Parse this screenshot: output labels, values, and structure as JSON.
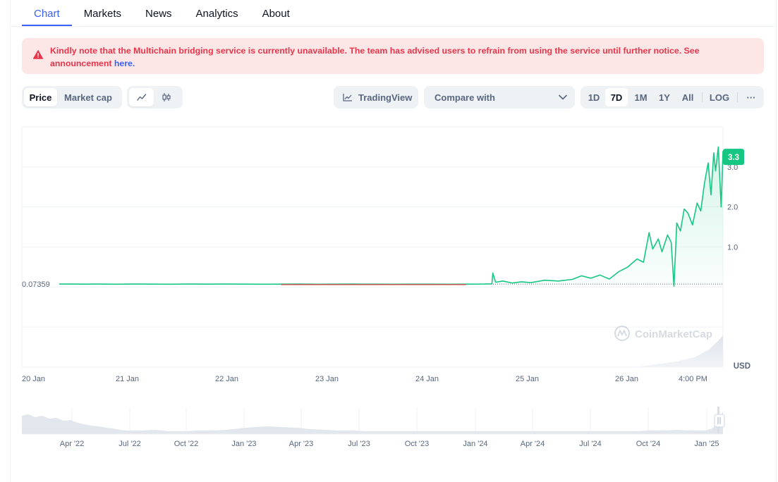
{
  "tabs": [
    "Chart",
    "Markets",
    "News",
    "Analytics",
    "About"
  ],
  "alert": {
    "text": "Kindly note that the Multichain bridging service is currently unavailable. The team has advised users to refrain from using the service until further notice. See announcement",
    "link": "here."
  },
  "toolbar": {
    "price_label": "Price",
    "marketcap_label": "Market cap",
    "tradingview_label": "TradingView",
    "compare_label": "Compare with",
    "ranges": [
      "1D",
      "7D",
      "1M",
      "1Y",
      "All"
    ],
    "active_range": "7D",
    "log_label": "LOG",
    "more_label": "···"
  },
  "chart_data": {
    "type": "line",
    "x_labels": [
      "20 Jan",
      "21 Jan",
      "22 Jan",
      "23 Jan",
      "24 Jan",
      "25 Jan",
      "26 Jan",
      "4:00 PM"
    ],
    "y_ticks": [
      "1.0",
      "2.0",
      "3.0"
    ],
    "current_price": "3.3",
    "reference_price": "0.07359",
    "currency": "USD",
    "watermark": "CoinMarketCap",
    "ylim": [
      -2,
      4
    ],
    "reference_value": 0.07359,
    "series": [
      {
        "points": [
          [
            0,
            0.074
          ],
          [
            0.1,
            0.075
          ],
          [
            0.25,
            0.072
          ],
          [
            0.4,
            0.074
          ],
          [
            0.6,
            0.071
          ],
          [
            0.8,
            0.075
          ],
          [
            1.0,
            0.073
          ],
          [
            1.2,
            0.071
          ],
          [
            1.4,
            0.074
          ],
          [
            1.6,
            0.072
          ],
          [
            1.8,
            0.075
          ],
          [
            2.0,
            0.072
          ],
          [
            2.2,
            0.071
          ],
          [
            2.4,
            0.073
          ],
          [
            2.6,
            0.074
          ],
          [
            2.8,
            0.071
          ],
          [
            3.0,
            0.073
          ],
          [
            3.2,
            0.075
          ],
          [
            3.4,
            0.072
          ],
          [
            3.6,
            0.071
          ],
          [
            3.8,
            0.073
          ],
          [
            4.0,
            0.072
          ],
          [
            4.2,
            0.071
          ],
          [
            4.4,
            0.073
          ],
          [
            4.6,
            0.074
          ],
          [
            4.68,
            0.08
          ],
          [
            4.69,
            0.35
          ],
          [
            4.72,
            0.12
          ],
          [
            4.8,
            0.15
          ],
          [
            4.9,
            0.1
          ],
          [
            5.0,
            0.13
          ],
          [
            5.1,
            0.11
          ],
          [
            5.25,
            0.17
          ],
          [
            5.4,
            0.15
          ],
          [
            5.55,
            0.19
          ],
          [
            5.65,
            0.28
          ],
          [
            5.75,
            0.22
          ],
          [
            5.85,
            0.3
          ],
          [
            5.95,
            0.2
          ],
          [
            6.05,
            0.38
          ],
          [
            6.15,
            0.5
          ],
          [
            6.25,
            0.7
          ],
          [
            6.32,
            0.62
          ],
          [
            6.38,
            1.36
          ],
          [
            6.42,
            0.95
          ],
          [
            6.48,
            1.2
          ],
          [
            6.52,
            0.88
          ],
          [
            6.58,
            1.3
          ],
          [
            6.62,
            1.12
          ],
          [
            6.65,
            0.02
          ],
          [
            6.68,
            1.6
          ],
          [
            6.72,
            1.4
          ],
          [
            6.76,
            1.95
          ],
          [
            6.8,
            1.85
          ],
          [
            6.85,
            1.55
          ],
          [
            6.9,
            2.1
          ],
          [
            6.94,
            1.9
          ],
          [
            6.98,
            2.6
          ],
          [
            7.02,
            3.1
          ],
          [
            7.05,
            2.3
          ],
          [
            7.08,
            3.35
          ],
          [
            7.1,
            2.9
          ],
          [
            7.13,
            3.5
          ],
          [
            7.16,
            2.0
          ],
          [
            7.18,
            3.4
          ]
        ]
      }
    ],
    "overview_x_labels": [
      "Apr '22",
      "Jul '22",
      "Oct '22",
      "Jan '23",
      "Apr '23",
      "Jul '23",
      "Oct '23",
      "Jan '24",
      "Apr '24",
      "Jul '24",
      "Oct '24",
      "Jan '25"
    ],
    "colors": {
      "up": "#16c784",
      "down": "#ea3943",
      "accent": "#3861fb",
      "grid": "#eff2f5"
    }
  }
}
